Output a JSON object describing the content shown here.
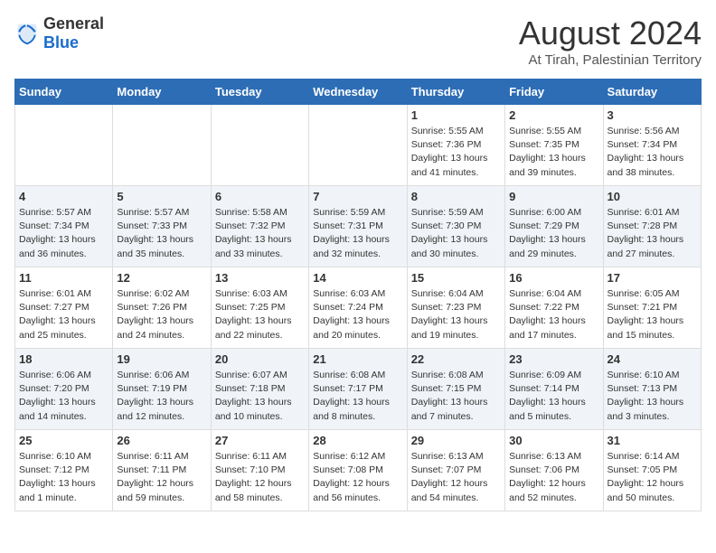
{
  "logo": {
    "general": "General",
    "blue": "Blue"
  },
  "title": "August 2024",
  "subtitle": "At Tirah, Palestinian Territory",
  "days_of_week": [
    "Sunday",
    "Monday",
    "Tuesday",
    "Wednesday",
    "Thursday",
    "Friday",
    "Saturday"
  ],
  "weeks": [
    [
      {
        "day": "",
        "content": ""
      },
      {
        "day": "",
        "content": ""
      },
      {
        "day": "",
        "content": ""
      },
      {
        "day": "",
        "content": ""
      },
      {
        "day": "1",
        "content": "Sunrise: 5:55 AM\nSunset: 7:36 PM\nDaylight: 13 hours and 41 minutes."
      },
      {
        "day": "2",
        "content": "Sunrise: 5:55 AM\nSunset: 7:35 PM\nDaylight: 13 hours and 39 minutes."
      },
      {
        "day": "3",
        "content": "Sunrise: 5:56 AM\nSunset: 7:34 PM\nDaylight: 13 hours and 38 minutes."
      }
    ],
    [
      {
        "day": "4",
        "content": "Sunrise: 5:57 AM\nSunset: 7:34 PM\nDaylight: 13 hours and 36 minutes."
      },
      {
        "day": "5",
        "content": "Sunrise: 5:57 AM\nSunset: 7:33 PM\nDaylight: 13 hours and 35 minutes."
      },
      {
        "day": "6",
        "content": "Sunrise: 5:58 AM\nSunset: 7:32 PM\nDaylight: 13 hours and 33 minutes."
      },
      {
        "day": "7",
        "content": "Sunrise: 5:59 AM\nSunset: 7:31 PM\nDaylight: 13 hours and 32 minutes."
      },
      {
        "day": "8",
        "content": "Sunrise: 5:59 AM\nSunset: 7:30 PM\nDaylight: 13 hours and 30 minutes."
      },
      {
        "day": "9",
        "content": "Sunrise: 6:00 AM\nSunset: 7:29 PM\nDaylight: 13 hours and 29 minutes."
      },
      {
        "day": "10",
        "content": "Sunrise: 6:01 AM\nSunset: 7:28 PM\nDaylight: 13 hours and 27 minutes."
      }
    ],
    [
      {
        "day": "11",
        "content": "Sunrise: 6:01 AM\nSunset: 7:27 PM\nDaylight: 13 hours and 25 minutes."
      },
      {
        "day": "12",
        "content": "Sunrise: 6:02 AM\nSunset: 7:26 PM\nDaylight: 13 hours and 24 minutes."
      },
      {
        "day": "13",
        "content": "Sunrise: 6:03 AM\nSunset: 7:25 PM\nDaylight: 13 hours and 22 minutes."
      },
      {
        "day": "14",
        "content": "Sunrise: 6:03 AM\nSunset: 7:24 PM\nDaylight: 13 hours and 20 minutes."
      },
      {
        "day": "15",
        "content": "Sunrise: 6:04 AM\nSunset: 7:23 PM\nDaylight: 13 hours and 19 minutes."
      },
      {
        "day": "16",
        "content": "Sunrise: 6:04 AM\nSunset: 7:22 PM\nDaylight: 13 hours and 17 minutes."
      },
      {
        "day": "17",
        "content": "Sunrise: 6:05 AM\nSunset: 7:21 PM\nDaylight: 13 hours and 15 minutes."
      }
    ],
    [
      {
        "day": "18",
        "content": "Sunrise: 6:06 AM\nSunset: 7:20 PM\nDaylight: 13 hours and 14 minutes."
      },
      {
        "day": "19",
        "content": "Sunrise: 6:06 AM\nSunset: 7:19 PM\nDaylight: 13 hours and 12 minutes."
      },
      {
        "day": "20",
        "content": "Sunrise: 6:07 AM\nSunset: 7:18 PM\nDaylight: 13 hours and 10 minutes."
      },
      {
        "day": "21",
        "content": "Sunrise: 6:08 AM\nSunset: 7:17 PM\nDaylight: 13 hours and 8 minutes."
      },
      {
        "day": "22",
        "content": "Sunrise: 6:08 AM\nSunset: 7:15 PM\nDaylight: 13 hours and 7 minutes."
      },
      {
        "day": "23",
        "content": "Sunrise: 6:09 AM\nSunset: 7:14 PM\nDaylight: 13 hours and 5 minutes."
      },
      {
        "day": "24",
        "content": "Sunrise: 6:10 AM\nSunset: 7:13 PM\nDaylight: 13 hours and 3 minutes."
      }
    ],
    [
      {
        "day": "25",
        "content": "Sunrise: 6:10 AM\nSunset: 7:12 PM\nDaylight: 13 hours and 1 minute."
      },
      {
        "day": "26",
        "content": "Sunrise: 6:11 AM\nSunset: 7:11 PM\nDaylight: 12 hours and 59 minutes."
      },
      {
        "day": "27",
        "content": "Sunrise: 6:11 AM\nSunset: 7:10 PM\nDaylight: 12 hours and 58 minutes."
      },
      {
        "day": "28",
        "content": "Sunrise: 6:12 AM\nSunset: 7:08 PM\nDaylight: 12 hours and 56 minutes."
      },
      {
        "day": "29",
        "content": "Sunrise: 6:13 AM\nSunset: 7:07 PM\nDaylight: 12 hours and 54 minutes."
      },
      {
        "day": "30",
        "content": "Sunrise: 6:13 AM\nSunset: 7:06 PM\nDaylight: 12 hours and 52 minutes."
      },
      {
        "day": "31",
        "content": "Sunrise: 6:14 AM\nSunset: 7:05 PM\nDaylight: 12 hours and 50 minutes."
      }
    ]
  ]
}
